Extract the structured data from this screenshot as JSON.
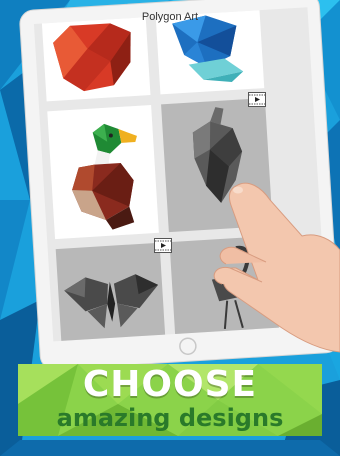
{
  "app": {
    "title": "Polygon Art"
  },
  "banner": {
    "headline": "CHOOSE",
    "subline": "amazing designs"
  },
  "colors": {
    "accent_green": "#8bd34a",
    "sky_blue": "#1e9fd8",
    "tablet_frame": "#f2f2f2"
  },
  "tiles": [
    {
      "name": "apple",
      "state": "colored"
    },
    {
      "name": "crystal-bird",
      "state": "colored"
    },
    {
      "name": "duck",
      "state": "colored"
    },
    {
      "name": "heart",
      "state": "uncolored",
      "badge": "video-icon"
    },
    {
      "name": "butterfly",
      "state": "uncolored",
      "badge": "video-icon"
    },
    {
      "name": "flamingo",
      "state": "uncolored"
    }
  ]
}
